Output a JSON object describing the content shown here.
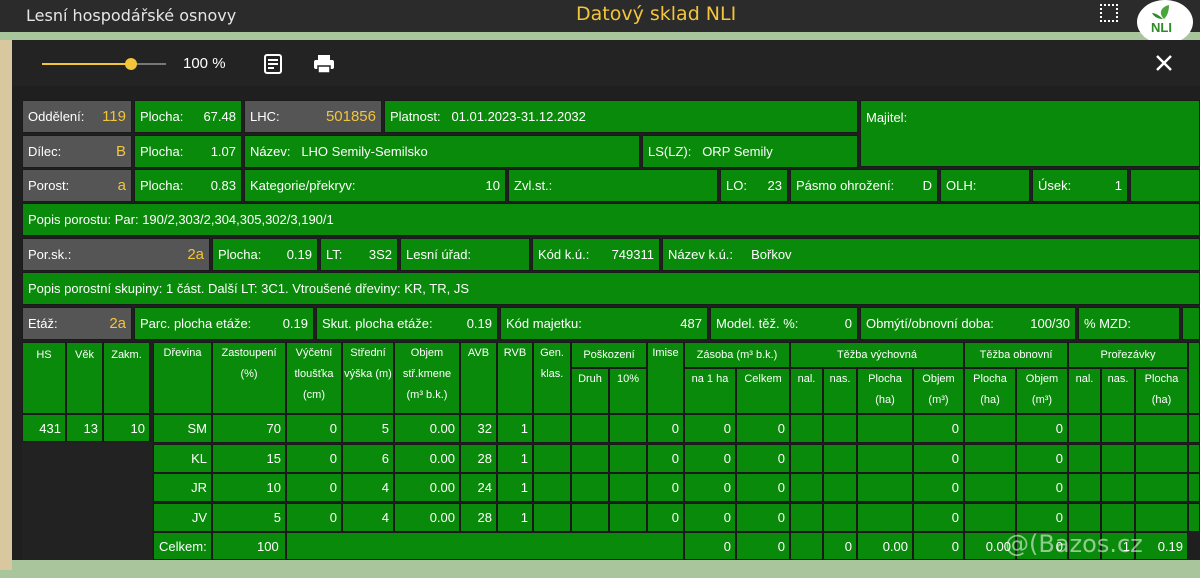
{
  "app": {
    "title": "Lesní hospodářské osnovy",
    "center_title": "Datový sklad NLI",
    "logo_text": "NLI"
  },
  "toolbar": {
    "zoom": "100 %"
  },
  "info": {
    "oddeleni_label": "Oddělení:",
    "oddeleni_val": "119",
    "plocha1_label": "Plocha:",
    "plocha1_val": "67.48",
    "lhc_label": "LHC:",
    "lhc_val": "501856",
    "platnost_label": "Platnost:",
    "platnost_val": "01.01.2023-31.12.2032",
    "majitel_label": "Majitel:",
    "dilec_label": "Dílec:",
    "dilec_val": "B",
    "plocha2_label": "Plocha:",
    "plocha2_val": "1.07",
    "nazev_label": "Název:",
    "nazev_val": "LHO Semily-Semilsko",
    "ls_label": "LS(LZ):",
    "ls_val": "ORP Semily",
    "porost_label": "Porost:",
    "porost_val": "a",
    "plocha3_label": "Plocha:",
    "plocha3_val": "0.83",
    "kategorie_label": "Kategorie/překryv:",
    "kategorie_val": "10",
    "zvlst_label": "Zvl.st.:",
    "lo_label": "LO:",
    "lo_val": "23",
    "pasmo_label": "Pásmo ohrožení:",
    "pasmo_val": "D",
    "olh_label": "OLH:",
    "usek_label": "Úsek:",
    "usek_val": "1",
    "popis_porostu_label": "Popis porostu:",
    "popis_porostu_val": "Par: 190/2,303/2,304,305,302/3,190/1",
    "porsk_label": "Por.sk.:",
    "porsk_val": "2a",
    "plocha4_label": "Plocha:",
    "plocha4_val": "0.19",
    "lt_label": "LT:",
    "lt_val": "3S2",
    "lesni_urad_label": "Lesní úřad:",
    "kod_ku_label": "Kód k.ú.:",
    "kod_ku_val": "749311",
    "nazev_ku_label": "Název k.ú.:",
    "nazev_ku_val": "Bořkov",
    "popis_skupiny_label": "Popis porostní skupiny:",
    "popis_skupiny_val": "1 část. Další LT: 3C1. Vtroušené dřeviny: KR, TR, JS",
    "etaz_label": "Etáž:",
    "etaz_val": "2a",
    "parc_label": "Parc. plocha etáže:",
    "parc_val": "0.19",
    "skut_label": "Skut. plocha etáže:",
    "skut_val": "0.19",
    "kod_majetku_label": "Kód majetku:",
    "kod_majetku_val": "487",
    "model_label": "Model. těž. %:",
    "model_val": "0",
    "obmyti_label": "Obmýtí/obnovní doba:",
    "obmyti_val": "100/30",
    "mzd_label": "% MZD:"
  },
  "left_table": {
    "headers": [
      "HS",
      "Věk",
      "Zakm."
    ],
    "row": [
      "431",
      "13",
      "10"
    ]
  },
  "main_table": {
    "h_drevina": "Dřevina",
    "h_zastoupeni": "Zastoupení (%)",
    "h_vycetni": "Výčetní tloušťka (cm)",
    "h_stredni": "Střední výška (m)",
    "h_objem": "Objem stř.kmene (m³ b.k.)",
    "h_avb": "AVB",
    "h_rvb": "RVB",
    "h_gen": "Gen. klas.",
    "h_poskozeni": "Poškození",
    "h_druh": "Druh",
    "h_10": "10%",
    "h_imise": "Imise",
    "h_zasoba": "Zásoba (m³ b.k.)",
    "h_na1ha": "na 1 ha",
    "h_celkem": "Celkem",
    "h_tezba_v": "Těžba výchovná",
    "h_nal": "nal.",
    "h_nas": "nas.",
    "h_plocha": "Plocha (ha)",
    "h_objem3": "Objem (m³)",
    "h_tezba_o": "Těžba obnovní",
    "h_plocha_o": "Plocha (ha)",
    "h_objem_o": "Objem (m³)",
    "h_prorez": "Prořezávky",
    "h_nal2": "nal.",
    "h_nas2": "nas.",
    "h_plocha_p": "Plocha (ha)",
    "rows": [
      [
        "SM",
        "70",
        "0",
        "5",
        "0.00",
        "32",
        "1",
        "0",
        "0",
        "0",
        "0",
        "0"
      ],
      [
        "KL",
        "15",
        "0",
        "6",
        "0.00",
        "28",
        "1",
        "0",
        "0",
        "0",
        "0",
        "0"
      ],
      [
        "JR",
        "10",
        "0",
        "4",
        "0.00",
        "24",
        "1",
        "0",
        "0",
        "0",
        "0",
        "0"
      ],
      [
        "JV",
        "5",
        "0",
        "4",
        "0.00",
        "28",
        "1",
        "0",
        "0",
        "0",
        "0",
        "0"
      ]
    ],
    "total_label": "Celkem:",
    "total_zast": "100",
    "total_vals": [
      "0",
      "0",
      "0",
      "0.00",
      "0",
      "0.00",
      "0",
      "1",
      "1",
      "0.19"
    ]
  },
  "watermark": "@(Bazos.cz"
}
